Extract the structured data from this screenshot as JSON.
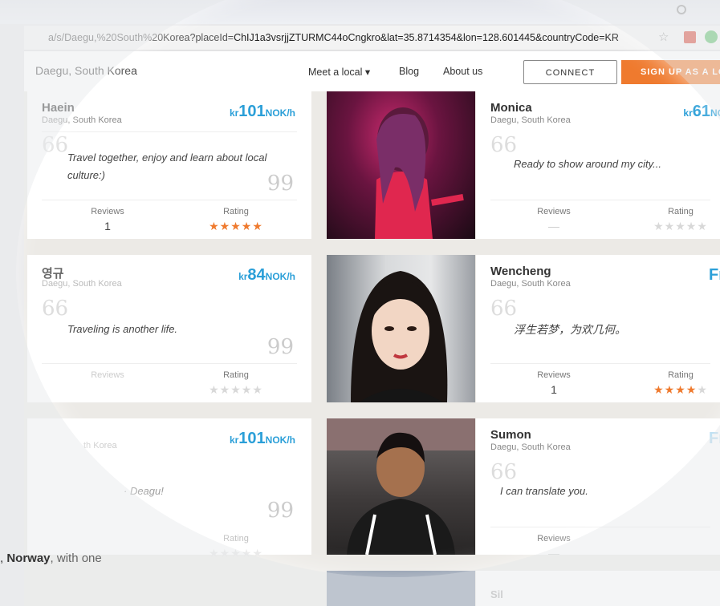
{
  "browser": {
    "url_prefix": "a/s/Daegu,%20South%20Korea?placeId=",
    "url_rest": "ChIJ1a3vsrjjZTURMC44oCngkro&lat=35.8714354&lon=128.601445&countryCode=KR"
  },
  "nav": {
    "location": "Daegu, South Korea",
    "meet": "Meet a local ▾",
    "blog": "Blog",
    "about": "About us",
    "connect": "CONNECT",
    "signup": "SIGN UP AS A LO"
  },
  "labels": {
    "reviews": "Reviews",
    "rating": "Rating",
    "dash": "—",
    "quote_open": "66",
    "quote_close": "99"
  },
  "locals": [
    {
      "name": "Haein",
      "city": "Daegu, South Korea",
      "currency": "kr",
      "price": "101",
      "suffix": "NOK/h",
      "bio": "Travel together, enjoy and learn about local culture:)",
      "reviews": "1",
      "rating": 5
    },
    {
      "name": "Monica",
      "city": "Daegu, South Korea",
      "currency": "kr",
      "price": "61",
      "suffix": "NO",
      "bio": "Ready to show around my city...",
      "reviews": "—",
      "rating": 0
    },
    {
      "name": "영규",
      "city": "Daegu, South Korea",
      "currency": "kr",
      "price": "84",
      "suffix": "NOK/h",
      "bio": "Traveling is another life.",
      "reviews": "—",
      "rating": 0
    },
    {
      "name": "Wencheng",
      "city": "Daegu, South Korea",
      "price_free": "Fr",
      "bio": "浮生若梦，为欢几何。",
      "reviews": "1",
      "rating": 4.5
    },
    {
      "name": "",
      "city": "th Korea",
      "currency": "kr",
      "price": "101",
      "suffix": "NOK/h",
      "bio": "· Deagu!",
      "reviews": "",
      "rating": 0
    },
    {
      "name": "Sumon",
      "city": "Daegu, South Korea",
      "price_free": "Fr",
      "bio": "I can translate you.",
      "reviews": "—",
      "rating": 0
    },
    {
      "name": "Sil",
      "city": ""
    }
  ],
  "bottom": {
    "prefix": ", ",
    "bold": "Norway",
    "rest": ", with one"
  },
  "colors": {
    "accent": "#2b9fd8",
    "orange": "#ef7a2e",
    "star": "#ef7a2e"
  }
}
